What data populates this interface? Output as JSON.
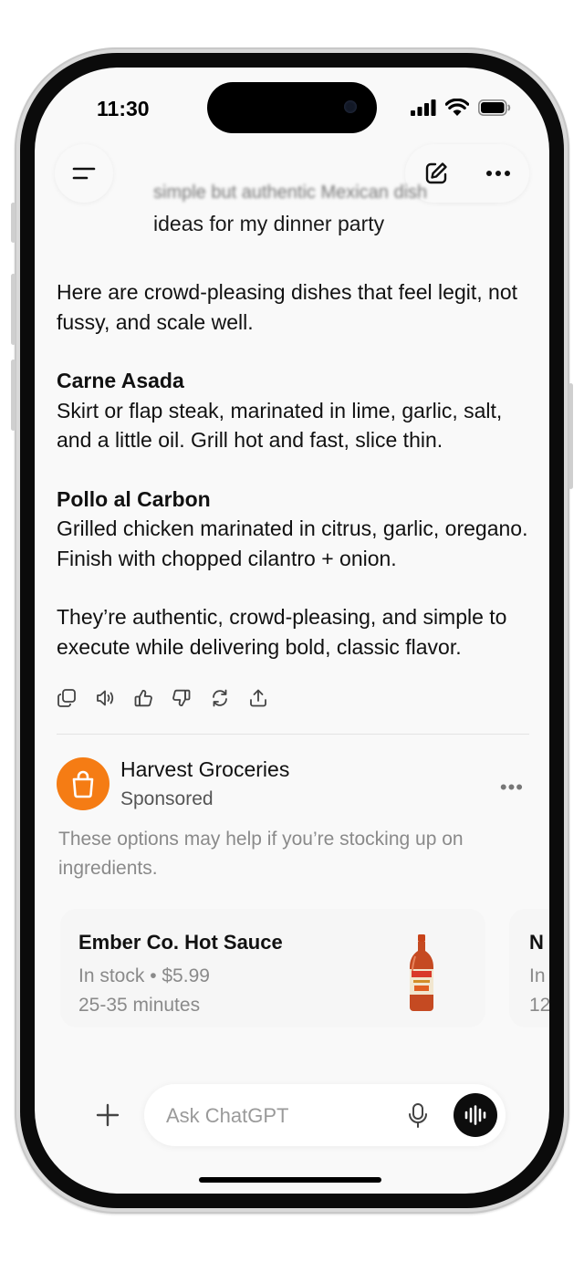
{
  "status_bar": {
    "time": "11:30"
  },
  "conversation": {
    "user_message_line1": "simple but authentic Mexican dish",
    "user_message_line2": "ideas for my dinner party",
    "answer": {
      "intro": "Here are crowd-pleasing dishes that feel legit, not fussy, and scale well.",
      "dishes": [
        {
          "name": "Carne Asada",
          "description": "Skirt or flap steak, marinated in lime, garlic, salt, and a little oil. Grill hot and fast, slice thin."
        },
        {
          "name": "Pollo al Carbon",
          "description": "Grilled chicken marinated in citrus, garlic, oregano. Finish with chopped cilantro + onion."
        }
      ],
      "closing": "They’re authentic, crowd-pleasing, and simple to execute while delivering bold, classic flavor."
    },
    "action_icons": [
      "copy-icon",
      "read-aloud-icon",
      "thumbs-up-icon",
      "thumbs-down-icon",
      "regenerate-icon",
      "share-icon"
    ]
  },
  "ad": {
    "advertiser": "Harvest Groceries",
    "label": "Sponsored",
    "description": "These options may help if you’re stocking up on ingredients.",
    "more_label": "•••",
    "brand_color": "#F57C14",
    "products": [
      {
        "name": "Ember Co. Hot Sauce",
        "stock": "In stock • $5.99",
        "delivery": "25-35 minutes"
      },
      {
        "name": "N",
        "stock": "In",
        "delivery": "12"
      }
    ]
  },
  "composer": {
    "placeholder": "Ask ChatGPT"
  }
}
